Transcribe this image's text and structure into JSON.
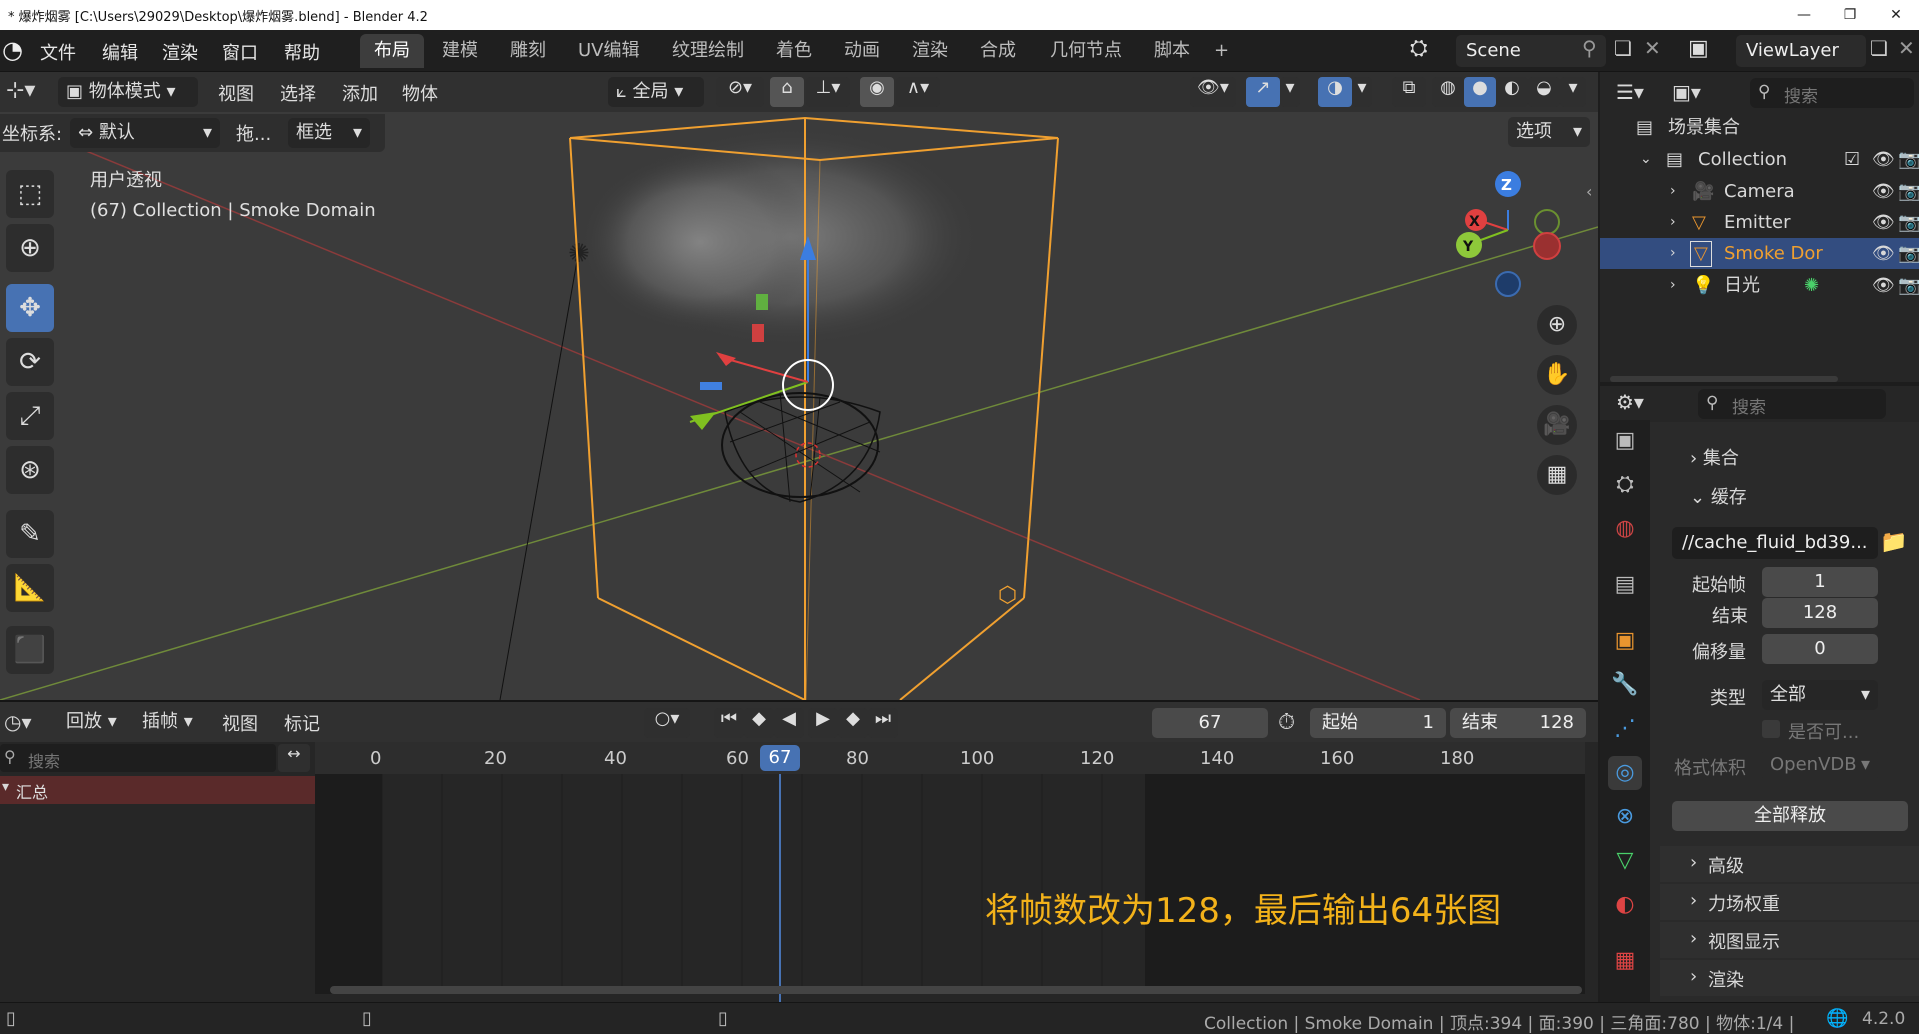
{
  "window": {
    "title": "* 爆炸烟雾 [C:\\Users\\29029\\Desktop\\爆炸烟雾.blend] - Blender 4.2",
    "minimize": "—",
    "maximize": "❐",
    "close": "✕"
  },
  "menu": [
    "文件",
    "编辑",
    "渲染",
    "窗口",
    "帮助"
  ],
  "workspaces": [
    "布局",
    "建模",
    "雕刻",
    "UV编辑",
    "纹理绘制",
    "着色",
    "动画",
    "渲染",
    "合成",
    "几何节点",
    "脚本"
  ],
  "workspace_add": "+",
  "scene": {
    "name": "Scene"
  },
  "viewlayer": {
    "name": "ViewLayer"
  },
  "viewport_header": {
    "mode": "物体模式",
    "view": "视图",
    "select": "选择",
    "add": "添加",
    "object": "物体",
    "transform_orientation": "全局"
  },
  "viewport_subheader": {
    "coords_label": "坐标系:",
    "coords_value": "默认",
    "drag_label": "拖...",
    "drag_value": "框选",
    "options": "选项"
  },
  "viewport": {
    "view_name": "用户透视",
    "context": "(67) Collection | Smoke Domain",
    "gizmo": {
      "z": "Z",
      "x": "X",
      "y": "Y"
    }
  },
  "outliner": {
    "search_placeholder": "搜索",
    "root": "场景集合",
    "collection": "Collection",
    "items": [
      {
        "name": "Camera",
        "color": "#c79e50"
      },
      {
        "name": "Emitter",
        "color": "#e9952f"
      },
      {
        "name": "Smoke Dor",
        "color": "#e9952f",
        "selected": true
      },
      {
        "name": "日光",
        "color": "#e9952f"
      }
    ]
  },
  "properties": {
    "search_placeholder": "搜索",
    "section_collection": "集合",
    "section_cache": "缓存",
    "cache_path": "//cache_fluid_bd39...",
    "frame_start_label": "起始帧",
    "frame_start": "1",
    "frame_end_label": "结束",
    "frame_end": "128",
    "offset_label": "偏移量",
    "offset": "0",
    "type_label": "类型",
    "type_value": "全部",
    "resumable_label": "是否可...",
    "format_label": "格式体积",
    "format_value": "OpenVDB",
    "free_all": "全部释放",
    "sections": [
      "高级",
      "力场权重",
      "视图显示",
      "渲染"
    ]
  },
  "timeline": {
    "playback": "回放",
    "keying": "插帧",
    "view": "视图",
    "marker": "标记",
    "current_frame": "67",
    "start_label": "起始",
    "start": "1",
    "end_label": "结束",
    "end": "128",
    "search_placeholder": "搜索",
    "summary": "汇总",
    "ticks": [
      "0",
      "20",
      "40",
      "60",
      "80",
      "100",
      "120",
      "140",
      "160",
      "180"
    ],
    "playhead": "67"
  },
  "annotation": "将帧数改为128，最后输出64张图",
  "statusbar": {
    "text": "Collection | Smoke Domain | 顶点:394 | 面:390 | 三角面:780 | 物体:1/4 |",
    "version": "4.2.0"
  },
  "colors": {
    "accent": "#4772b3",
    "selection": "#f0a030",
    "playhead": "#4772b3",
    "annotation": "#f3b21a"
  }
}
